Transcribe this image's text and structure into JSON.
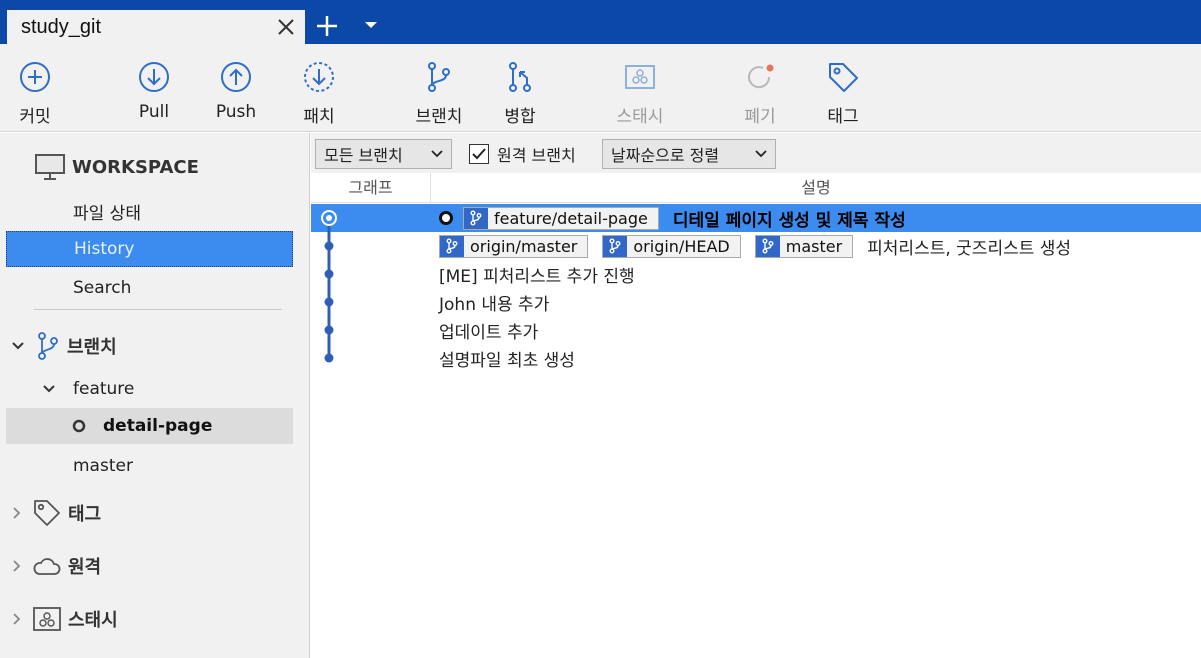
{
  "tabbar": {
    "title": "study_git"
  },
  "toolbar": {
    "commit": "커밋",
    "pull": "Pull",
    "push": "Push",
    "patch": "패치",
    "branch": "브랜치",
    "merge": "병합",
    "stash": "스태시",
    "discard": "폐기",
    "tag": "태그"
  },
  "sidebar": {
    "workspace": "WORKSPACE",
    "file_status": "파일 상태",
    "history": "History",
    "search": "Search",
    "branches": "브랜치",
    "feature": "feature",
    "detail_page": "detail-page",
    "master": "master",
    "tags": "태그",
    "remotes": "원격",
    "stashes": "스태시"
  },
  "filters": {
    "branch_filter": "모든 브랜치",
    "remote_branches": "원격 브랜치",
    "sort": "날짜순으로 정렬"
  },
  "columns": {
    "graph": "그래프",
    "description": "설명"
  },
  "commits": [
    {
      "refs": [
        "feature/detail-page"
      ],
      "message": "디테일 페이지 생성 및 제목 작성",
      "head": true
    },
    {
      "refs": [
        "origin/master",
        "origin/HEAD",
        "master"
      ],
      "message": "피처리스트, 굿즈리스트 생성"
    },
    {
      "refs": [],
      "message": "[ME] 피처리스트 추가 진행"
    },
    {
      "refs": [],
      "message": "John 내용 추가"
    },
    {
      "refs": [],
      "message": "업데이트 추가"
    },
    {
      "refs": [],
      "message": "설명파일 최초 생성"
    }
  ],
  "colors": {
    "accent": "#0b48a8",
    "selection": "#3c8cf0",
    "graph": "#2f5fb5"
  }
}
